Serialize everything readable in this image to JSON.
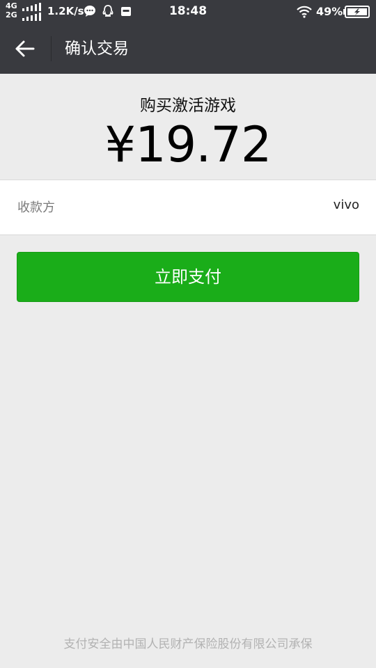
{
  "status_bar": {
    "network_top": "4G",
    "network_bottom": "2G",
    "speed": "1.2K/s",
    "time": "18:48",
    "battery_percent": "49%",
    "icons": [
      "signal-bars-icon",
      "chat-bubble-icon",
      "qq-penguin-icon",
      "bag-icon",
      "wifi-icon",
      "battery-charging-icon"
    ]
  },
  "header": {
    "title": "确认交易",
    "back_icon": "arrow-left-icon"
  },
  "payment": {
    "product": "购买激活游戏",
    "amount": "¥19.72",
    "payee_label": "收款方",
    "payee_value": "vivo"
  },
  "actions": {
    "pay_label": "立即支付"
  },
  "footer": {
    "insurance_note": "支付安全由中国人民财产保险股份有限公司承保"
  },
  "colors": {
    "header_bg": "#393a3f",
    "page_bg": "#ececec",
    "primary_green": "#1aad19"
  }
}
